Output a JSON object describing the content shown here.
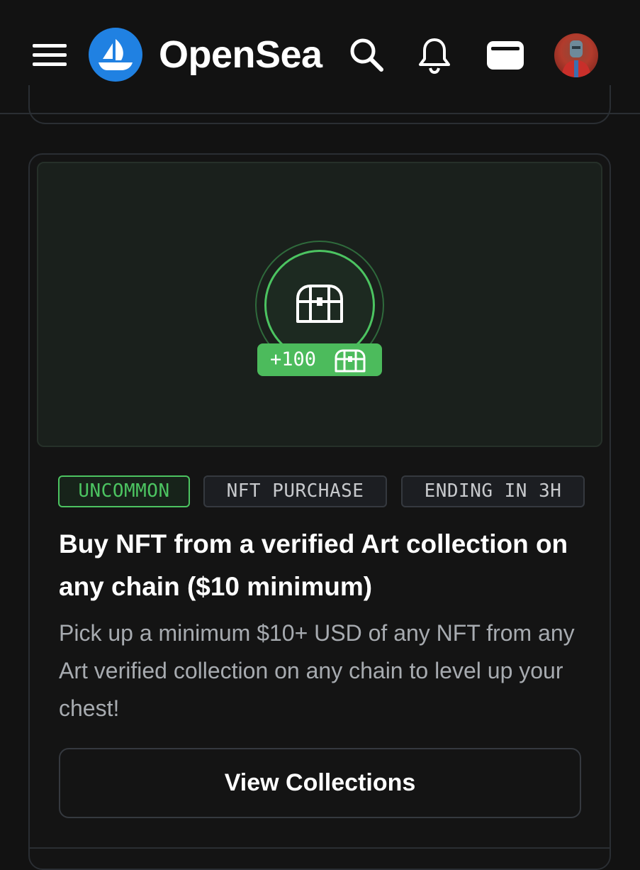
{
  "header": {
    "brand_name": "OpenSea",
    "brand_color": "#2081e2",
    "icons": [
      "menu-icon",
      "opensea-logo-icon",
      "search-icon",
      "bell-icon",
      "wallet-icon",
      "avatar"
    ]
  },
  "quest": {
    "points": "+100",
    "tags": {
      "rarity": "UNCOMMON",
      "type": "NFT PURCHASE",
      "ending": "ENDING IN 3H"
    },
    "title": "Buy NFT from a verified Art collection on any chain ($10 minimum)",
    "description": "Pick up a minimum $10+ USD of any NFT from any Art verified collection on any chain to level up your chest!",
    "button_label": "View Collections",
    "accent_color": "#4cc461"
  }
}
